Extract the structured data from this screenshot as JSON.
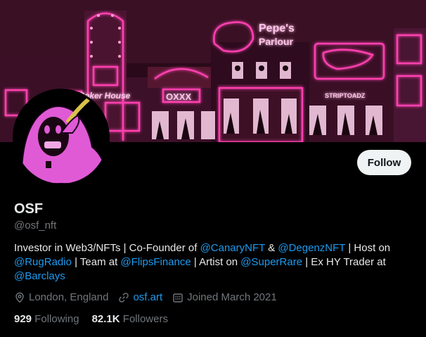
{
  "banner": {
    "sign_pepe_line1": "Pepe's",
    "sign_pepe_line2": "Parlour",
    "sign_house": "Poker House",
    "sign_oxxx": "OXXX",
    "sign_striptoadz": "STRIPTOADZ"
  },
  "profile": {
    "follow_label": "Follow",
    "name": "OSF",
    "handle": "@osf_nft"
  },
  "bio": {
    "t1": "Investor in Web3/NFTs | Co-Founder of ",
    "m1": "@CanaryNFT",
    "t2": " & ",
    "m2": "@DegenzNFT",
    "t3": " | Host on ",
    "m3": "@RugRadio",
    "t4": " | Team at ",
    "m4": "@FlipsFinance",
    "t5": " | Artist on ",
    "m5": "@SuperRare",
    "t6": " | Ex HY Trader at ",
    "m6": "@Barclays"
  },
  "meta": {
    "location": "London, England",
    "website": "osf.art",
    "joined": "Joined March 2021"
  },
  "stats": {
    "following_count": "929",
    "following_label": "Following",
    "followers_count": "82.1K",
    "followers_label": "Followers"
  },
  "colors": {
    "link": "#1d9bf0",
    "neon_pink": "#ff3fb0",
    "avatar_pink": "#e05ad6"
  }
}
